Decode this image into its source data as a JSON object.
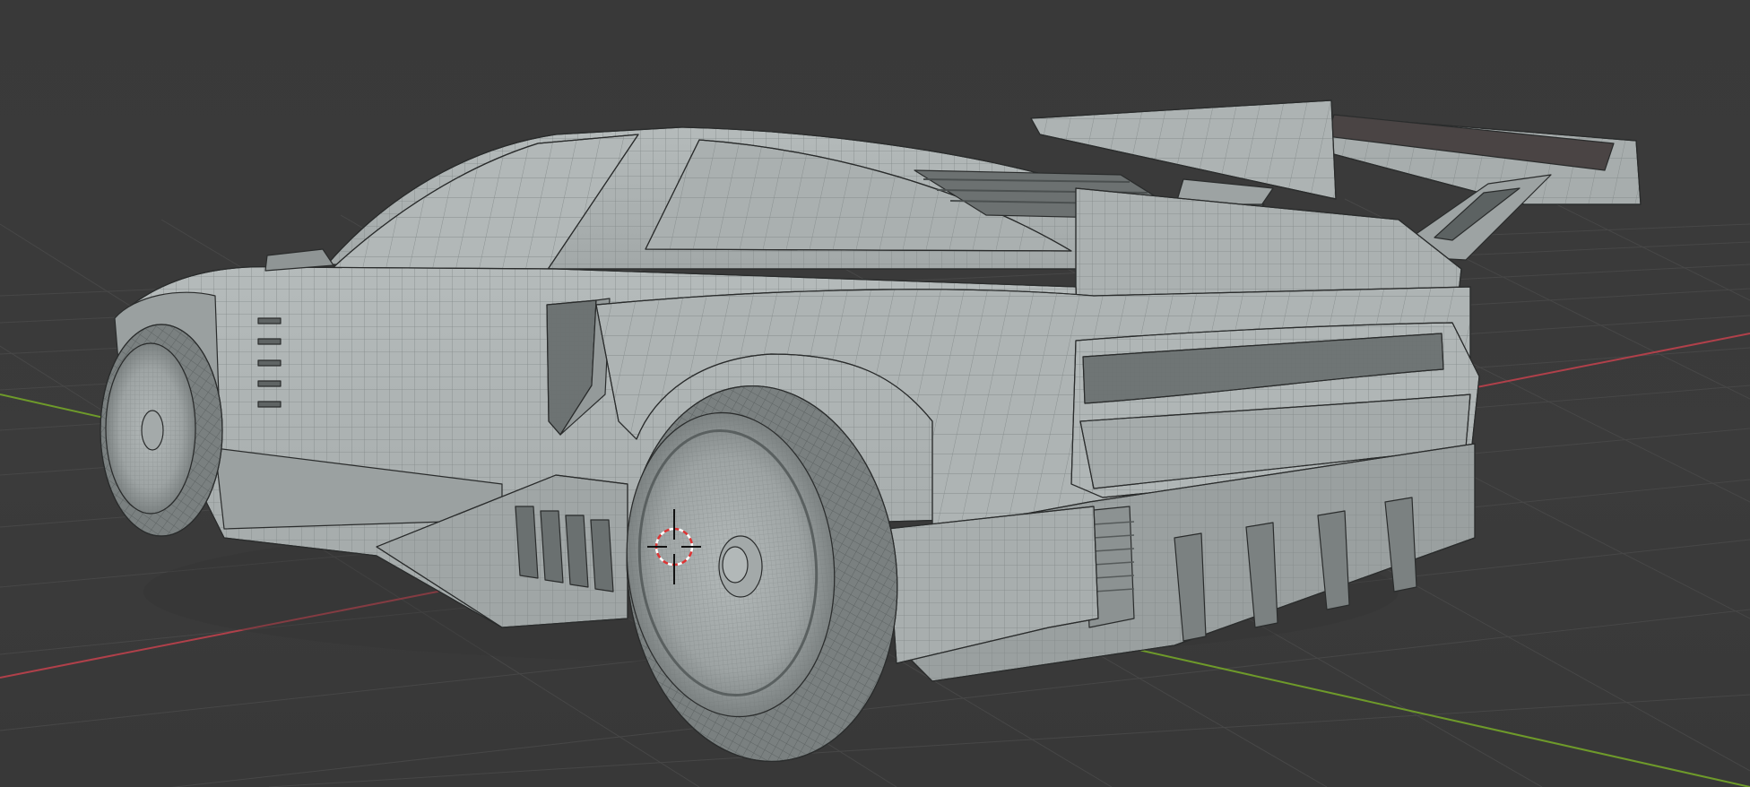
{
  "viewport": {
    "background_color": "#3a3a3a",
    "grid_color": "#444444",
    "x_axis_color": "#b0404a",
    "y_axis_color": "#6e9a2a",
    "mesh_fill": "#a9afaf",
    "mesh_shade": "#8d9393",
    "mesh_dark": "#5f6464",
    "wire_color": "#7b8282",
    "edge_color": "#2a2c2c"
  },
  "scene": {
    "object": "car-mesh",
    "cursor_icon": "3d-cursor-icon"
  }
}
